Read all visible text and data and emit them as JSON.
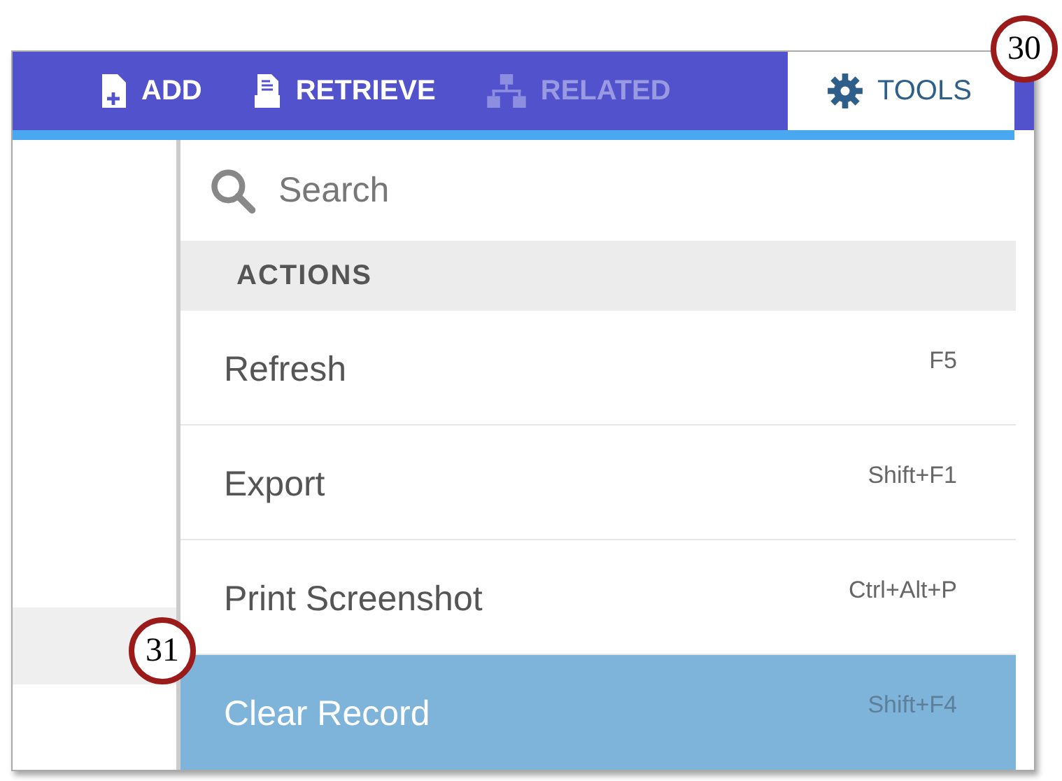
{
  "toolbar": {
    "tabs": [
      {
        "label": "ADD",
        "kind": "add",
        "selected": false,
        "disabled": false
      },
      {
        "label": "RETRIEVE",
        "kind": "retrieve",
        "selected": false,
        "disabled": false
      },
      {
        "label": "RELATED",
        "kind": "related",
        "selected": false,
        "disabled": true
      },
      {
        "label": "TOOLS",
        "kind": "tools",
        "selected": true,
        "disabled": false
      }
    ]
  },
  "menu": {
    "search": {
      "placeholder": "Search"
    },
    "section": "ACTIONS",
    "items": [
      {
        "label": "Refresh",
        "shortcut": "F5",
        "selected": false
      },
      {
        "label": "Export",
        "shortcut": "Shift+F1",
        "selected": false
      },
      {
        "label": "Print Screenshot",
        "shortcut": "Ctrl+Alt+P",
        "selected": false
      },
      {
        "label": "Clear Record",
        "shortcut": "Shift+F4",
        "selected": true
      }
    ]
  },
  "callouts": [
    {
      "number": "30"
    },
    {
      "number": "31"
    }
  ]
}
